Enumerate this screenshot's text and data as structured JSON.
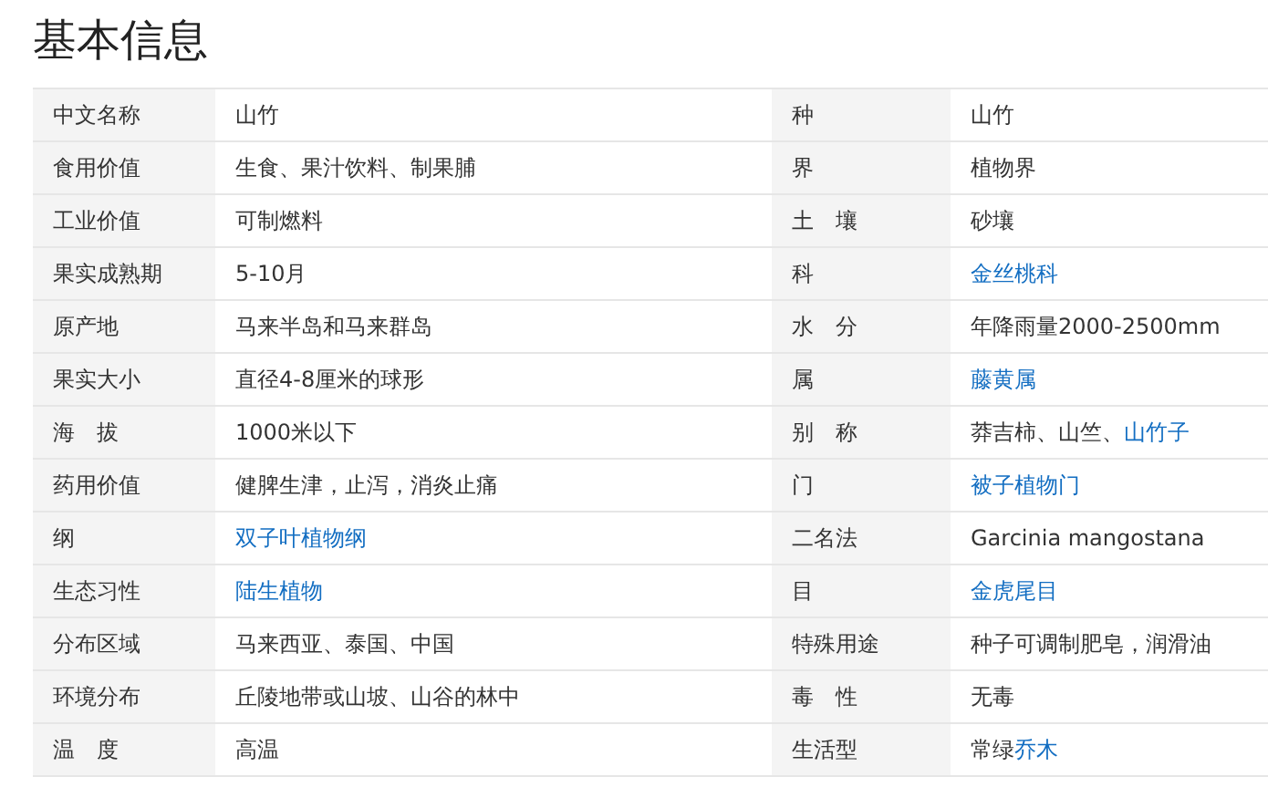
{
  "title": "基本信息",
  "rows": [
    {
      "left": {
        "label": "中文名称",
        "value": [
          {
            "text": "山竹",
            "link": false
          }
        ]
      },
      "right": {
        "label": "种",
        "value": [
          {
            "text": "山竹",
            "link": false
          }
        ]
      }
    },
    {
      "left": {
        "label": "食用价值",
        "value": [
          {
            "text": "生食、果汁饮料、制果脯",
            "link": false
          }
        ]
      },
      "right": {
        "label": "界",
        "value": [
          {
            "text": "植物界",
            "link": false
          }
        ]
      }
    },
    {
      "left": {
        "label": "工业价值",
        "value": [
          {
            "text": "可制燃料",
            "link": false
          }
        ]
      },
      "right": {
        "label": "土　壤",
        "value": [
          {
            "text": "砂壤",
            "link": false
          }
        ]
      }
    },
    {
      "left": {
        "label": "果实成熟期",
        "value": [
          {
            "text": "5-10月",
            "link": false
          }
        ]
      },
      "right": {
        "label": "科",
        "value": [
          {
            "text": "金丝桃科",
            "link": true
          }
        ]
      }
    },
    {
      "left": {
        "label": "原产地",
        "value": [
          {
            "text": "马来半岛和马来群岛",
            "link": false
          }
        ]
      },
      "right": {
        "label": "水　分",
        "value": [
          {
            "text": "年降雨量2000-2500mm",
            "link": false
          }
        ]
      }
    },
    {
      "left": {
        "label": "果实大小",
        "value": [
          {
            "text": "直径4-8厘米的球形",
            "link": false
          }
        ]
      },
      "right": {
        "label": "属",
        "value": [
          {
            "text": "藤黄属",
            "link": true
          }
        ]
      }
    },
    {
      "left": {
        "label": "海　拔",
        "value": [
          {
            "text": "1000米以下",
            "link": false
          }
        ]
      },
      "right": {
        "label": "别　称",
        "value": [
          {
            "text": "莽吉柿、山竺、",
            "link": false
          },
          {
            "text": "山竹子",
            "link": true
          }
        ]
      }
    },
    {
      "left": {
        "label": "药用价值",
        "value": [
          {
            "text": "健脾生津，止泻，消炎止痛",
            "link": false
          }
        ]
      },
      "right": {
        "label": "门",
        "value": [
          {
            "text": "被子植物门",
            "link": true
          }
        ]
      }
    },
    {
      "left": {
        "label": "纲",
        "value": [
          {
            "text": "双子叶植物纲",
            "link": true
          }
        ]
      },
      "right": {
        "label": "二名法",
        "value": [
          {
            "text": "Garcinia mangostana",
            "link": false
          }
        ]
      }
    },
    {
      "left": {
        "label": "生态习性",
        "value": [
          {
            "text": "陆生植物",
            "link": true
          }
        ]
      },
      "right": {
        "label": "目",
        "value": [
          {
            "text": "金虎尾目",
            "link": true
          }
        ]
      }
    },
    {
      "left": {
        "label": "分布区域",
        "value": [
          {
            "text": "马来西亚、泰国、中国",
            "link": false
          }
        ]
      },
      "right": {
        "label": "特殊用途",
        "value": [
          {
            "text": "种子可调制肥皂，润滑油",
            "link": false
          }
        ]
      }
    },
    {
      "left": {
        "label": "环境分布",
        "value": [
          {
            "text": "丘陵地带或山坡、山谷的林中",
            "link": false
          }
        ]
      },
      "right": {
        "label": "毒　性",
        "value": [
          {
            "text": "无毒",
            "link": false
          }
        ]
      }
    },
    {
      "left": {
        "label": "温　度",
        "value": [
          {
            "text": "高温",
            "link": false
          }
        ]
      },
      "right": {
        "label": "生活型",
        "value": [
          {
            "text": "常绿",
            "link": false
          },
          {
            "text": "乔木",
            "link": true
          }
        ]
      }
    }
  ]
}
